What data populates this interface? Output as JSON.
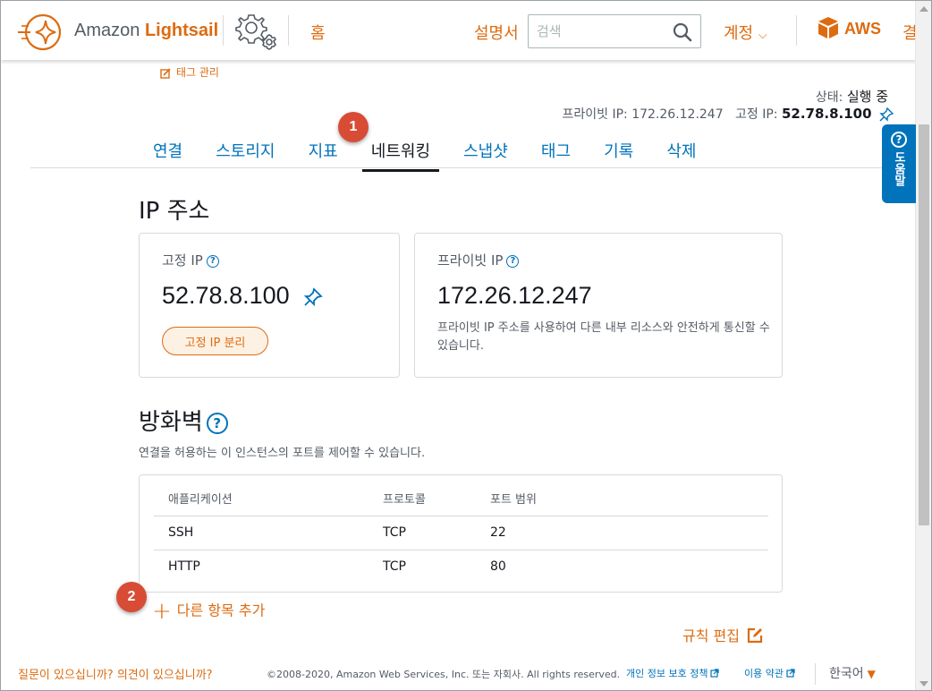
{
  "header": {
    "logo_brand": "Amazon",
    "logo_product": "Lightsail",
    "nav_home": "홈",
    "nav_docs": "설명서",
    "search_placeholder": "검색",
    "nav_account": "계정",
    "nav_aws": "AWS",
    "nav_billing_partial": "결"
  },
  "help_tab": {
    "label": "도움말"
  },
  "instance": {
    "tag_manage": "태그 관리",
    "status_label": "상태:",
    "status_value": "실행 중",
    "private_ip_label": "프라이빗 IP:",
    "private_ip_value": "172.26.12.247",
    "static_ip_label": "고정 IP:",
    "static_ip_value": "52.78.8.100"
  },
  "tabs": [
    {
      "label": "연결"
    },
    {
      "label": "스토리지"
    },
    {
      "label": "지표"
    },
    {
      "label": "네트워킹"
    },
    {
      "label": "스냅샷"
    },
    {
      "label": "태그"
    },
    {
      "label": "기록"
    },
    {
      "label": "삭제"
    }
  ],
  "active_tab": "네트워킹",
  "badges": {
    "one": "1",
    "two": "2"
  },
  "ip_section": {
    "title": "IP 주소",
    "static_card": {
      "label": "고정 IP",
      "value": "52.78.8.100",
      "button": "고정 IP 분리"
    },
    "private_card": {
      "label": "프라이빗 IP",
      "value": "172.26.12.247",
      "description": "프라이빗 IP 주소를 사용하여 다른 내부 리소스와 안전하게 통신할 수 있습니다."
    }
  },
  "firewall": {
    "title": "방화벽",
    "description": "연결을 허용하는 이 인스턴스의 포트를 제어할 수 있습니다.",
    "columns": [
      "애플리케이션",
      "프로토콜",
      "포트 범위"
    ],
    "rows": [
      {
        "app": "SSH",
        "protocol": "TCP",
        "port": "22"
      },
      {
        "app": "HTTP",
        "protocol": "TCP",
        "port": "80"
      }
    ],
    "add_link": "다른 항목 추가",
    "edit_rules": "규칙 편집"
  },
  "footer": {
    "feedback": "질문이 있으십니까? 의견이 있으십니까?",
    "copyright": "©2008-2020, Amazon Web Services, Inc. 또는 자회사. All rights reserved.",
    "privacy": "개인 정보 보호 정책",
    "terms": "이용 약관",
    "language": "한국어"
  },
  "colors": {
    "accent_orange": "#dd6b10",
    "link_blue": "#0073bb",
    "badge_red": "#d84c35",
    "text_dark": "#16191f"
  }
}
